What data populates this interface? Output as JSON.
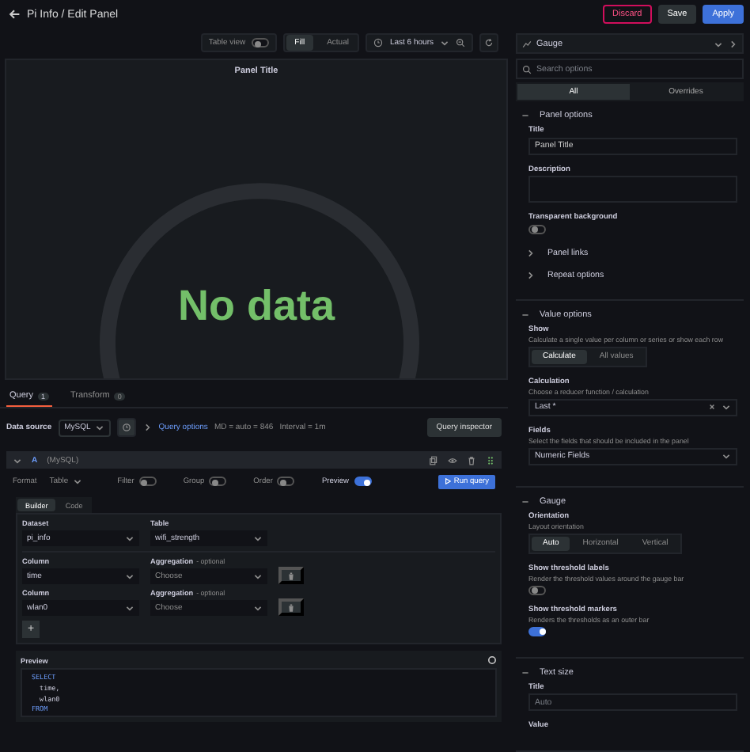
{
  "header": {
    "title": "Pi Info / Edit Panel",
    "buttons": [
      {
        "label": "Discard",
        "kind": "danger"
      },
      {
        "label": "Save",
        "kind": "secondary"
      },
      {
        "label": "Apply",
        "kind": "primary"
      }
    ]
  },
  "toolbar": {
    "table_view": {
      "label": "Table view",
      "on": false
    },
    "view_modes": [
      {
        "label": "Fill",
        "selected": true
      },
      {
        "label": "Actual",
        "selected": false
      }
    ],
    "time_range": "Last 6 hours"
  },
  "visualization": {
    "name": "Gauge"
  },
  "panel": {
    "title": "Panel Title",
    "message": "No data"
  },
  "query_tabs": [
    {
      "label": "Query",
      "count": "1",
      "selected": true
    },
    {
      "label": "Transform",
      "count": "0",
      "selected": false
    }
  ],
  "data_source": {
    "label": "Data source",
    "value": "MySQL",
    "query_options": "Query options",
    "summary": [
      "MD = auto = 846",
      "Interval = 1m"
    ],
    "inspector": "Query inspector"
  },
  "query": {
    "ref": "A",
    "source": "(MySQL)",
    "format_label": "Format",
    "format": "Table",
    "toggles": [
      {
        "label": "Filter",
        "on": false
      },
      {
        "label": "Group",
        "on": false
      },
      {
        "label": "Order",
        "on": false
      },
      {
        "label": "Preview",
        "on": true
      }
    ],
    "run": "Run query",
    "modes": [
      {
        "label": "Builder",
        "selected": true
      },
      {
        "label": "Code",
        "selected": false
      }
    ],
    "dataset": {
      "label": "Dataset",
      "value": "pi_info"
    },
    "table": {
      "label": "Table",
      "value": "wifi_strength"
    },
    "columns": [
      {
        "label": "Column",
        "value": "time",
        "agg_label": "Aggregation",
        "agg_hint": "- optional",
        "agg_placeholder": "Choose"
      },
      {
        "label": "Column",
        "value": "wlan0",
        "agg_label": "Aggregation",
        "agg_hint": "- optional",
        "agg_placeholder": "Choose"
      }
    ],
    "add_button": "+",
    "preview": {
      "label": "Preview",
      "lines": [
        "SELECT",
        "  time,",
        "  wlan0",
        "FROM"
      ]
    }
  },
  "options": {
    "search_placeholder": "Search options",
    "tabs": [
      {
        "label": "All",
        "selected": true
      },
      {
        "label": "Overrides",
        "selected": false
      }
    ],
    "sections": [
      {
        "title": "Panel options",
        "expanded": true,
        "items": [
          {
            "kind": "input",
            "label": "Title",
            "value": "Panel Title"
          },
          {
            "kind": "textarea",
            "label": "Description"
          },
          {
            "kind": "switch",
            "label": "Transparent background",
            "on": false
          },
          {
            "kind": "category",
            "label": "Panel links",
            "expanded": false
          },
          {
            "kind": "category",
            "label": "Repeat options",
            "expanded": false
          }
        ]
      },
      {
        "title": "Value options",
        "expanded": true,
        "items": [
          {
            "kind": "radio",
            "label": "Show",
            "description": "Calculate a single value per column or series or show each row",
            "options": [
              {
                "label": "Calculate",
                "selected": true
              },
              {
                "label": "All values",
                "selected": false
              }
            ]
          },
          {
            "kind": "select",
            "label": "Calculation",
            "description": "Choose a reducer function / calculation",
            "value": "Last *",
            "clearable": true
          },
          {
            "kind": "select",
            "label": "Fields",
            "description": "Select the fields that should be included in the panel",
            "value": "Numeric Fields",
            "clearable": false
          }
        ]
      },
      {
        "title": "Gauge",
        "expanded": true,
        "items": [
          {
            "kind": "radio",
            "label": "Orientation",
            "description": "Layout orientation",
            "options": [
              {
                "label": "Auto",
                "selected": true
              },
              {
                "label": "Horizontal",
                "selected": false
              },
              {
                "label": "Vertical",
                "selected": false
              }
            ]
          },
          {
            "kind": "switch",
            "label": "Show threshold labels",
            "description": "Render the threshold values around the gauge bar",
            "on": false
          },
          {
            "kind": "switch",
            "label": "Show threshold markers",
            "description": "Renders the thresholds as an outer bar",
            "on": true
          }
        ]
      },
      {
        "title": "Text size",
        "expanded": true,
        "items": [
          {
            "kind": "input",
            "label": "Title",
            "placeholder": "Auto"
          },
          {
            "kind": "label",
            "label": "Value"
          }
        ]
      }
    ]
  }
}
